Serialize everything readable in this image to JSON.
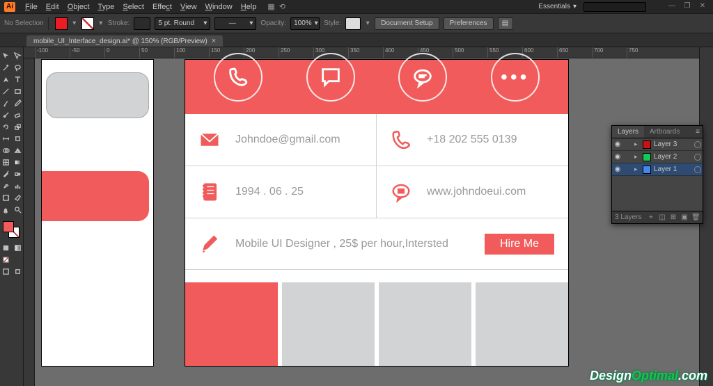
{
  "app": {
    "logo": "Ai"
  },
  "menu": {
    "items": [
      "File",
      "Edit",
      "Object",
      "Type",
      "Select",
      "Effect",
      "View",
      "Window",
      "Help"
    ],
    "workspace": "Essentials"
  },
  "window_controls": {
    "minimize": "—",
    "restore": "❐",
    "close": "✕"
  },
  "options": {
    "no_selection": "No Selection",
    "fill_color": "#ed1c24",
    "stroke_label": "Stroke:",
    "stroke_weight": "5 pt. Round",
    "opacity_label": "Opacity:",
    "opacity_value": "100%",
    "style_label": "Style:",
    "doc_setup": "Document Setup",
    "preferences": "Preferences"
  },
  "doc_tab": {
    "title": "mobile_UI_Interface_design.ai* @ 150% (RGB/Preview)",
    "close": "×"
  },
  "ruler": {
    "ticks": [
      "-100",
      "-50",
      "0",
      "50",
      "100",
      "150",
      "200",
      "250",
      "300",
      "350",
      "400",
      "450",
      "500",
      "550",
      "600",
      "650",
      "700",
      "750"
    ]
  },
  "tools": {
    "names": [
      "selection",
      "direct-selection",
      "magic-wand",
      "lasso",
      "pen",
      "type",
      "line",
      "rectangle",
      "paintbrush",
      "pencil",
      "blob-brush",
      "eraser",
      "rotate",
      "scale",
      "width",
      "free-transform",
      "shape-builder",
      "perspective",
      "mesh",
      "gradient",
      "eyedropper",
      "blend",
      "symbol-sprayer",
      "column-graph",
      "artboard",
      "slice",
      "hand",
      "zoom"
    ],
    "fill": "#f15b5b",
    "stroke": "none"
  },
  "design": {
    "email": "Johndoe@gmail.com",
    "phone": "+18 202 555 0139",
    "dob": "1994 . 06 . 25",
    "website": "www.johndoeui.com",
    "tagline": "Mobile UI Designer , 25$ per hour,Intersted",
    "hire": "Hire Me"
  },
  "layers": {
    "tab1": "Layers",
    "tab2": "Artboards",
    "items": [
      {
        "name": "Layer 3",
        "color": "#c11",
        "visible": true,
        "selected": false
      },
      {
        "name": "Layer 2",
        "color": "#1c5",
        "visible": true,
        "selected": false
      },
      {
        "name": "Layer 1",
        "color": "#48e",
        "visible": true,
        "selected": true
      }
    ],
    "count": "3 Layers"
  },
  "watermark": {
    "a": "Design",
    "b": "Optimal",
    "c": ".com"
  }
}
